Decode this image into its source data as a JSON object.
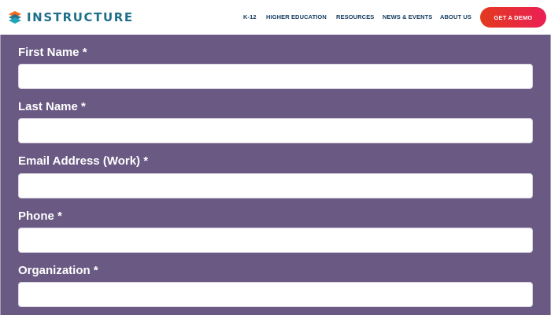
{
  "header": {
    "logo": {
      "text": "INSTRUCTURE",
      "icon": "instructure-logo-icon"
    },
    "nav": [
      {
        "label": "K-12"
      },
      {
        "label": "HIGHER EDUCATION"
      },
      {
        "label": "RESOURCES"
      },
      {
        "label": "NEWS & EVENTS"
      },
      {
        "label": "ABOUT US"
      }
    ],
    "cta": {
      "label": "GET A DEMO"
    }
  },
  "form": {
    "fields": [
      {
        "label": "First Name *",
        "value": "",
        "placeholder": ""
      },
      {
        "label": "Last Name *",
        "value": "",
        "placeholder": ""
      },
      {
        "label": "Email Address (Work) *",
        "value": "",
        "placeholder": ""
      },
      {
        "label": "Phone *",
        "value": "",
        "placeholder": ""
      },
      {
        "label": "Organization *",
        "value": "",
        "placeholder": ""
      }
    ]
  },
  "colors": {
    "brand_text": "#1f6f8b",
    "nav_text": "#153d61",
    "cta_start": "#e23a1f",
    "cta_end": "#eb1f55",
    "form_background": "#695983"
  }
}
